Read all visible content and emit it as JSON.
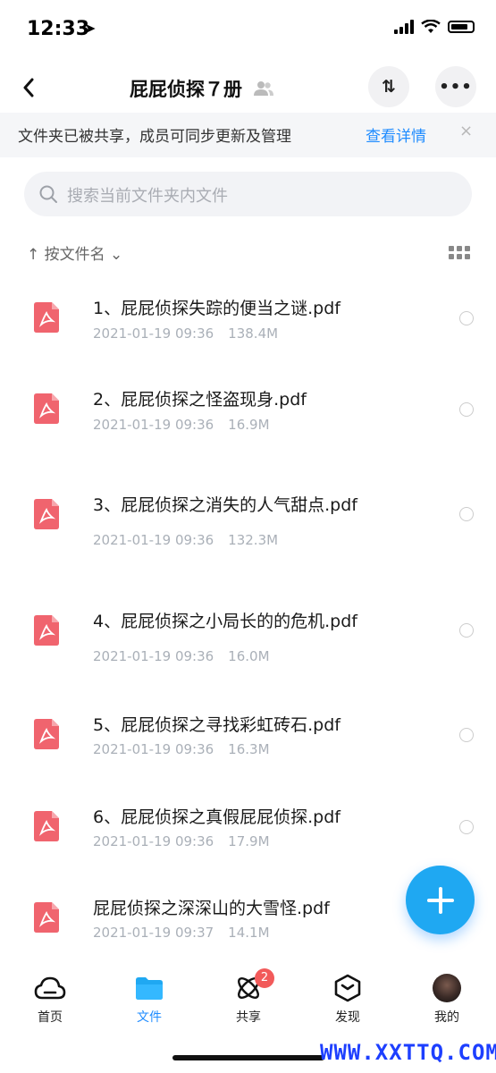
{
  "status": {
    "time": "12:33"
  },
  "nav": {
    "title": "屁屁侦探７册",
    "sort_glyph": "⇅",
    "more_glyph": "•••"
  },
  "banner": {
    "text": "文件夹已被共享，成员可同步更新及管理",
    "link": "查看详情",
    "close": "×"
  },
  "search": {
    "placeholder": "搜索当前文件夹内文件"
  },
  "sort": {
    "label": "↑ 按文件名 ⌄"
  },
  "files": [
    {
      "name": "1、屁屁侦探失踪的便当之谜.pdf",
      "date": "2021-01-19 09:36",
      "size": "138.4M"
    },
    {
      "name": "2、屁屁侦探之怪盗现身.pdf",
      "date": "2021-01-19 09:36",
      "size": "16.9M"
    },
    {
      "name": "3、屁屁侦探之消失的人气甜点.pdf",
      "date": "2021-01-19 09:36",
      "size": "132.3M"
    },
    {
      "name": "4、屁屁侦探之小局长的的危机.pdf",
      "date": "2021-01-19 09:36",
      "size": "16.0M"
    },
    {
      "name": "5、屁屁侦探之寻找彩虹砖石.pdf",
      "date": "2021-01-19 09:36",
      "size": "16.3M"
    },
    {
      "name": "6、屁屁侦探之真假屁屁侦探.pdf",
      "date": "2021-01-19 09:36",
      "size": "17.9M"
    },
    {
      "name": "屁屁侦探之深深山的大雪怪.pdf",
      "date": "2021-01-19 09:37",
      "size": "14.1M"
    }
  ],
  "tabs": [
    {
      "label": "首页",
      "icon": "cloud-icon"
    },
    {
      "label": "文件",
      "icon": "folder-icon",
      "active": true
    },
    {
      "label": "共享",
      "icon": "atom-icon",
      "badge": "2"
    },
    {
      "label": "发现",
      "icon": "cube-icon"
    },
    {
      "label": "我的",
      "icon": "avatar"
    }
  ],
  "watermark": "WWW.XXTTQ.COM",
  "colors": {
    "accent": "#1f8cff",
    "fab": "#1fa8f2",
    "pdf": "#f0646e",
    "badge": "#f25a5a"
  }
}
